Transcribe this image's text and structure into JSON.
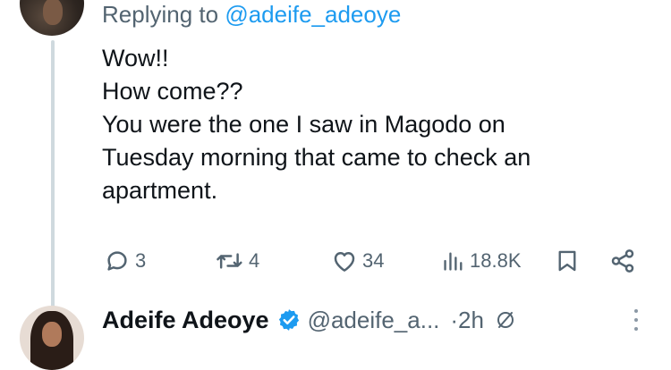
{
  "reply_header": {
    "prefix": "Replying to",
    "handle": "@adeife_adeoye"
  },
  "tweet": {
    "lines": [
      "Wow!!",
      "How come??",
      "You were the one I saw in Magodo on",
      "Tuesday morning that came to check an",
      "apartment."
    ]
  },
  "actions": {
    "replies": "3",
    "reposts": "4",
    "likes": "34",
    "views": "18.8K",
    "icons": [
      "reply-icon",
      "repost-icon",
      "heart-icon",
      "views-icon",
      "bookmark-icon",
      "share-icon"
    ]
  },
  "next_tweet": {
    "name": "Adeife Adeoye",
    "handle": "@adeife_a...",
    "time": "·2h"
  },
  "colors": {
    "accent": "#1d9bf0",
    "muted": "#536471",
    "text": "#0f1419",
    "thread_line": "#cfd9de"
  }
}
